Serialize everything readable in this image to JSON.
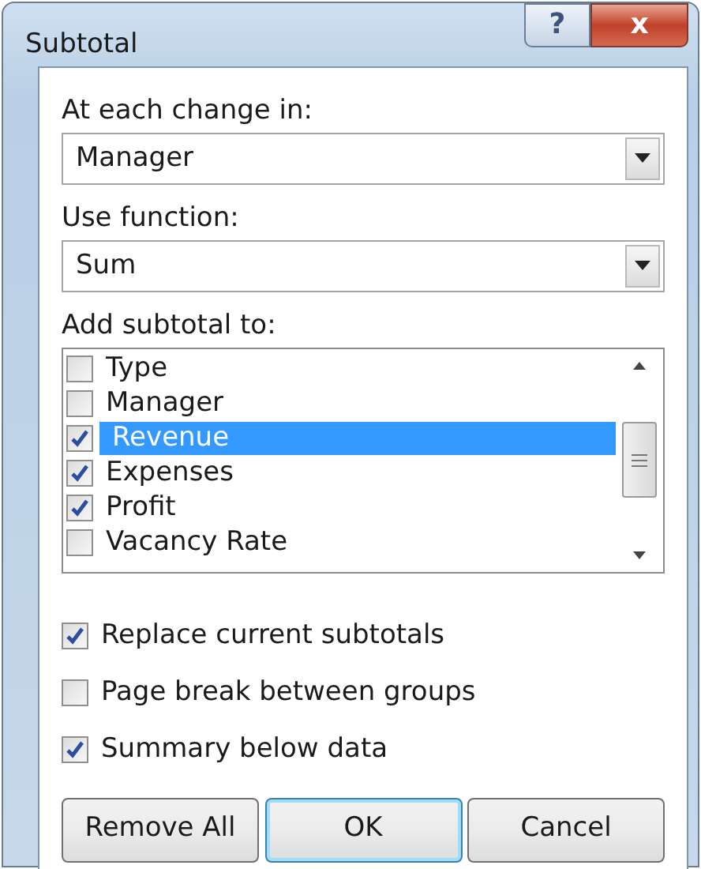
{
  "window": {
    "title": "Subtotal",
    "help_button": "?",
    "close_button": "x"
  },
  "group_by": {
    "label": "At each change in:",
    "value": "Manager"
  },
  "function": {
    "label": "Use function:",
    "value": "Sum"
  },
  "add_subtotal_to": {
    "label": "Add subtotal to:",
    "items": [
      {
        "label": "Type",
        "checked": false,
        "selected": false
      },
      {
        "label": "Manager",
        "checked": false,
        "selected": false
      },
      {
        "label": "Revenue",
        "checked": true,
        "selected": true
      },
      {
        "label": "Expenses",
        "checked": true,
        "selected": false
      },
      {
        "label": "Profit",
        "checked": true,
        "selected": false
      },
      {
        "label": "Vacancy Rate",
        "checked": false,
        "selected": false
      }
    ]
  },
  "options": [
    {
      "label": "Replace current subtotals",
      "checked": true
    },
    {
      "label": "Page break between groups",
      "checked": false
    },
    {
      "label": "Summary below data",
      "checked": true
    }
  ],
  "buttons": [
    {
      "label": "Remove All",
      "default": false
    },
    {
      "label": "OK",
      "default": true
    },
    {
      "label": "Cancel",
      "default": false
    }
  ]
}
